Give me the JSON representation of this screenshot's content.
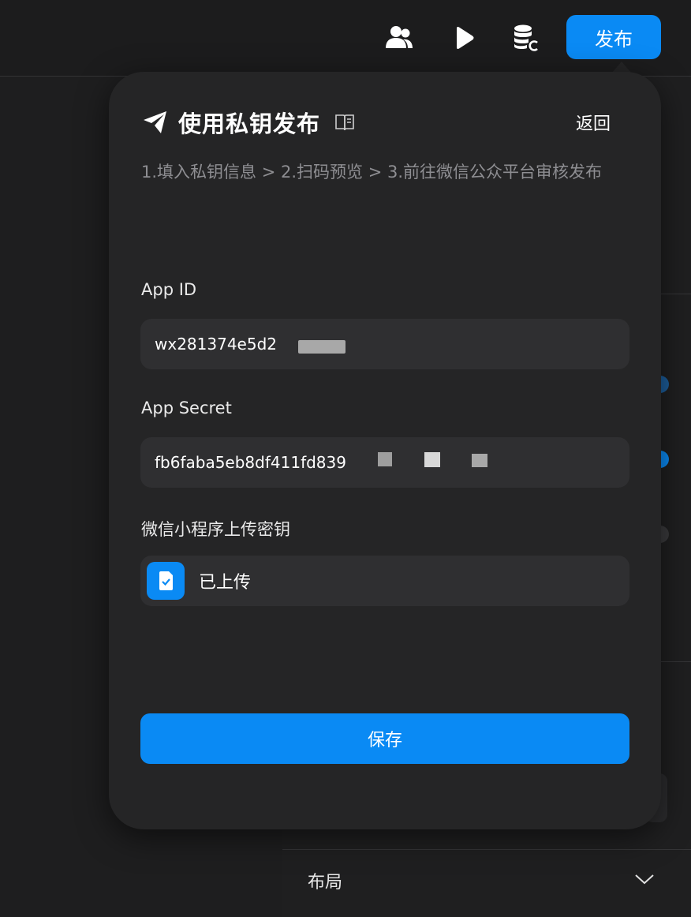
{
  "topbar": {
    "icons": [
      "users-icon",
      "play-icon",
      "database-icon"
    ],
    "publish_label": "发布"
  },
  "popover": {
    "title": "使用私钥发布",
    "back_label": "返回",
    "steps": "1.填入私钥信息 > 2.扫码预览 > 3.前往微信公众平台审核发布",
    "app_id": {
      "label": "App ID",
      "value": "wx281374e5d2"
    },
    "app_secret": {
      "label": "App Secret",
      "value": "fb6faba5eb8df411fd839"
    },
    "upload_key": {
      "label": "微信小程序上传密钥",
      "status": "已上传"
    },
    "save_label": "保存"
  },
  "background": {
    "layout_label": "布局"
  },
  "colors": {
    "accent": "#0a8af4",
    "popover_bg": "#252526",
    "field_bg": "#2f2f31"
  }
}
